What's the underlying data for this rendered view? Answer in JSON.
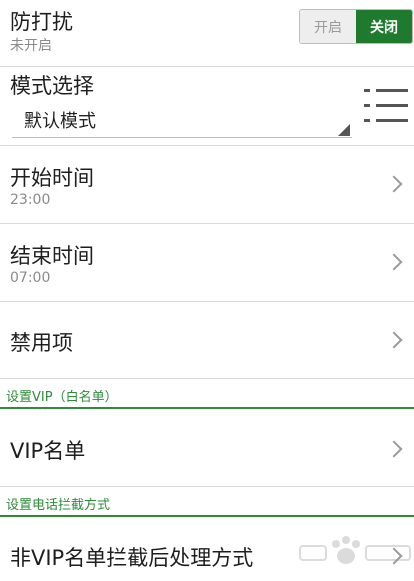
{
  "dnd": {
    "title": "防打扰",
    "status": "未开启",
    "toggle_on_label": "开启",
    "toggle_off_label": "关闭"
  },
  "mode": {
    "title": "模式选择",
    "selected": "默认模式"
  },
  "start_time": {
    "title": "开始时间",
    "value": "23:00"
  },
  "end_time": {
    "title": "结束时间",
    "value": "07:00"
  },
  "disabled_items": {
    "title": "禁用项"
  },
  "vip_section": {
    "label": "设置VIP（白名单）"
  },
  "vip_list": {
    "title": "VIP名单"
  },
  "intercept_section": {
    "label": "设置电话拦截方式"
  },
  "non_vip": {
    "title": "非VIP名单拦截后处理方式"
  },
  "colors": {
    "accent": "#1f7a2e",
    "section": "#2e8b3a",
    "divider": "#d9d9d9"
  },
  "icons": {
    "menu": "list-icon",
    "chevron": "chevron-right-icon"
  }
}
